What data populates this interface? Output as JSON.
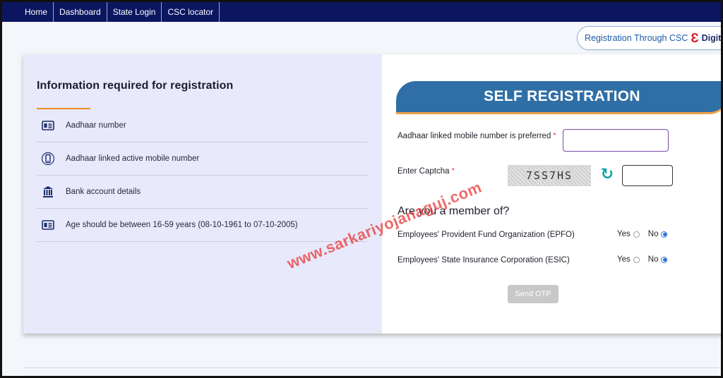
{
  "nav": {
    "items": [
      {
        "label": "Home"
      },
      {
        "label": "Dashboard"
      },
      {
        "label": "State Login"
      },
      {
        "label": "CSC locator"
      }
    ]
  },
  "csc": {
    "text": "Registration Through CSC",
    "brand": "DigitalSe"
  },
  "info": {
    "title": "Information required for registration",
    "items": [
      {
        "icon": "id-card-icon",
        "label": "Aadhaar number"
      },
      {
        "icon": "mobile-phone-icon",
        "label": "Aadhaar linked active mobile number"
      },
      {
        "icon": "bank-icon",
        "label": "Bank account details"
      },
      {
        "icon": "id-card-icon",
        "label": "Age should be between 16-59 years (08-10-1961 to 07-10-2005)"
      }
    ]
  },
  "form": {
    "banner_title": "SELF REGISTRATION",
    "mobile_label": "Aadhaar linked mobile number is preferred",
    "mobile_value": "",
    "captcha_label": "Enter Captcha",
    "captcha_text": "7SS7HS",
    "captcha_value": "",
    "member_title": "Are you a member of?",
    "questions": [
      {
        "label": "Employees' Provident Fund Organization (EPFO)",
        "yes": "Yes",
        "no": "No",
        "selected": "No"
      },
      {
        "label": "Employees' State Insurance Corporation (ESIC)",
        "yes": "Yes",
        "no": "No",
        "selected": "No"
      }
    ],
    "required_mark": "*",
    "send_otp": "Send OTP"
  },
  "watermark": "www.sarkariyojanaguj.com",
  "colors": {
    "nav_bg": "#0c1660",
    "banner": "#2f6fa6",
    "accent_orange": "#f08a24",
    "refresh": "#13a3a3",
    "radio_selected": "#2a6edb"
  }
}
